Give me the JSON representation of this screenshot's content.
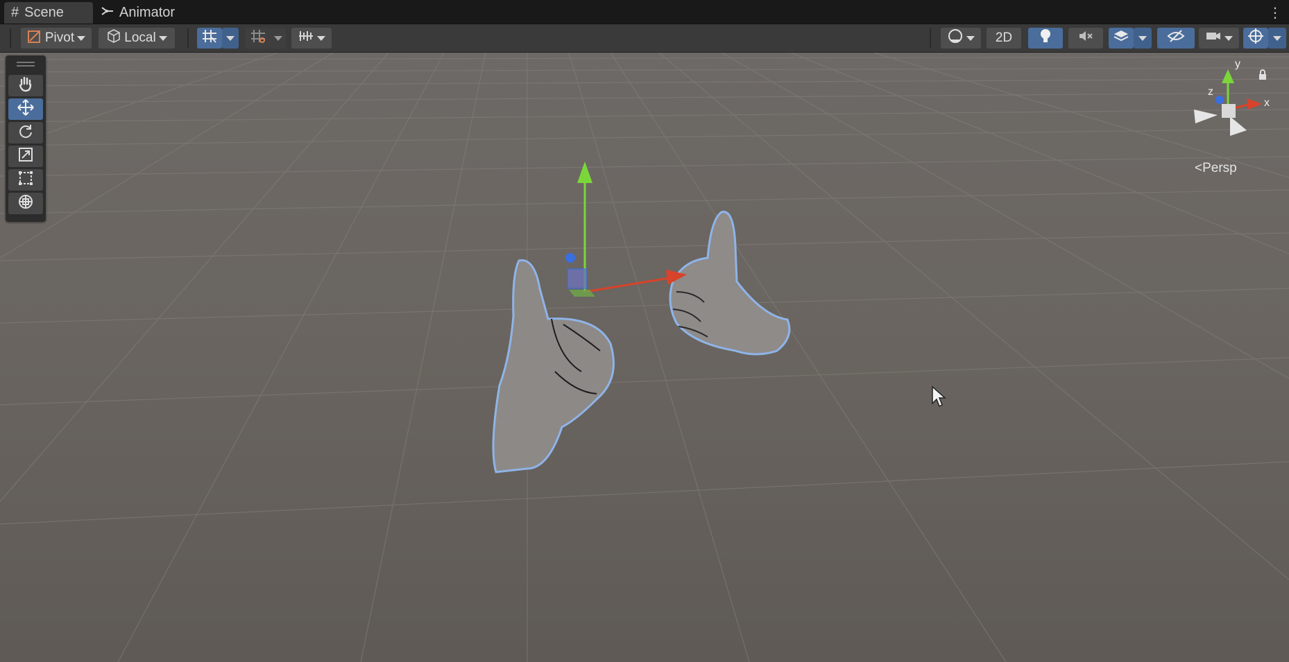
{
  "tabs": [
    {
      "label": "Scene",
      "icon": "grid-hash-icon",
      "active": true
    },
    {
      "label": "Animator",
      "icon": "animator-icon",
      "active": false
    }
  ],
  "toolbar": {
    "pivot_label": "Pivot",
    "local_label": "Local",
    "mode_2d_label": "2D"
  },
  "tools": [
    {
      "name": "hand-tool",
      "icon": "hand-icon",
      "active": false
    },
    {
      "name": "move-tool",
      "icon": "move-icon",
      "active": true
    },
    {
      "name": "rotate-tool",
      "icon": "rotate-icon",
      "active": false
    },
    {
      "name": "scale-tool",
      "icon": "scale-icon",
      "active": false
    },
    {
      "name": "rect-tool",
      "icon": "rect-icon",
      "active": false
    },
    {
      "name": "transform-tool",
      "icon": "transform-icon",
      "active": false
    }
  ],
  "gizmo": {
    "x_label": "x",
    "y_label": "y",
    "z_label": "z",
    "projection_label": "Persp"
  },
  "colors": {
    "accent": "#4a6d9b",
    "axis_x": "#d8432b",
    "axis_y": "#7bd63a",
    "axis_z": "#3a6fe0",
    "viewport_bg": "#6a6560"
  }
}
